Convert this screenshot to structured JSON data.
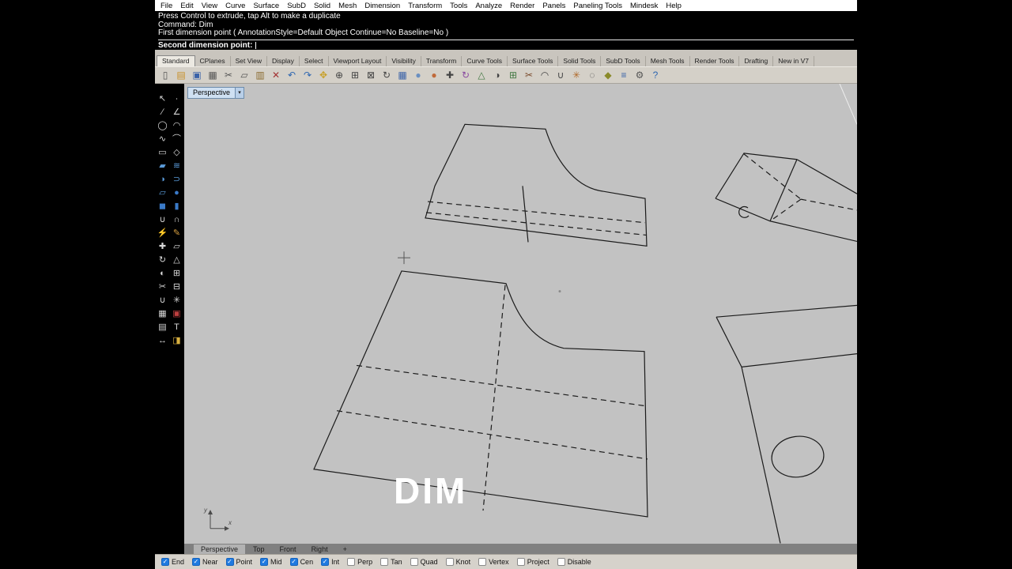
{
  "colors": {
    "accent_blue": "#1f7ae0",
    "viewport_bg": "#c2c2c2",
    "chrome_bg": "#d4d0c8",
    "command_bg": "#000000",
    "wire": "#1b1b1b"
  },
  "menu": {
    "items": [
      "File",
      "Edit",
      "View",
      "Curve",
      "Surface",
      "SubD",
      "Solid",
      "Mesh",
      "Dimension",
      "Transform",
      "Tools",
      "Analyze",
      "Render",
      "Panels",
      "Paneling Tools",
      "Mindesk",
      "Help"
    ]
  },
  "command": {
    "history": [
      "Press Control to extrude, tap Alt to make a duplicate",
      "Command: Dim",
      "First dimension point ( AnnotationStyle=Default Object Continue=No Baseline=No )"
    ],
    "prompt": "Second dimension point:"
  },
  "toolbar_tabs": {
    "tabs": [
      {
        "label": "Standard",
        "active": true
      },
      {
        "label": "CPlanes"
      },
      {
        "label": "Set View"
      },
      {
        "label": "Display"
      },
      {
        "label": "Select"
      },
      {
        "label": "Viewport Layout"
      },
      {
        "label": "Visibility"
      },
      {
        "label": "Transform"
      },
      {
        "label": "Curve Tools"
      },
      {
        "label": "Surface Tools"
      },
      {
        "label": "Solid Tools"
      },
      {
        "label": "SubD Tools"
      },
      {
        "label": "Mesh Tools"
      },
      {
        "label": "Render Tools"
      },
      {
        "label": "Drafting"
      },
      {
        "label": "New in V7"
      }
    ]
  },
  "toolbar": {
    "icons": [
      {
        "name": "new-file-icon",
        "glyph": "▯",
        "color": "#555555"
      },
      {
        "name": "open-file-icon",
        "glyph": "▤",
        "color": "#c89028"
      },
      {
        "name": "save-icon",
        "glyph": "▣",
        "color": "#3a62a8"
      },
      {
        "name": "print-icon",
        "glyph": "▦",
        "color": "#555555"
      },
      {
        "name": "cut-icon",
        "glyph": "✂",
        "color": "#555555"
      },
      {
        "name": "copy-icon",
        "glyph": "▱",
        "color": "#555555"
      },
      {
        "name": "paste-icon",
        "glyph": "▥",
        "color": "#8a6b2f"
      },
      {
        "name": "delete-icon",
        "glyph": "✕",
        "color": "#a33333"
      },
      {
        "name": "undo-icon",
        "glyph": "↶",
        "color": "#2e66b0"
      },
      {
        "name": "redo-icon",
        "glyph": "↷",
        "color": "#2e66b0"
      },
      {
        "name": "pan-icon",
        "glyph": "✥",
        "color": "#c8a028"
      },
      {
        "name": "zoom-icon",
        "glyph": "⊕",
        "color": "#444444"
      },
      {
        "name": "zoom-window-icon",
        "glyph": "⊞",
        "color": "#444444"
      },
      {
        "name": "zoom-extents-icon",
        "glyph": "⊠",
        "color": "#444444"
      },
      {
        "name": "rotate-view-icon",
        "glyph": "↻",
        "color": "#444444"
      },
      {
        "name": "viewport-layout-icon",
        "glyph": "▦",
        "color": "#3a62a8"
      },
      {
        "name": "shaded-view-icon",
        "glyph": "●",
        "color": "#6a8fc0"
      },
      {
        "name": "render-icon",
        "glyph": "●",
        "color": "#c06a3a"
      },
      {
        "name": "move-icon",
        "glyph": "✚",
        "color": "#444444"
      },
      {
        "name": "rotate-icon",
        "glyph": "↻",
        "color": "#8a4aa0"
      },
      {
        "name": "scale-icon",
        "glyph": "△",
        "color": "#447a44"
      },
      {
        "name": "mirror-icon",
        "glyph": "◑",
        "color": "#444444"
      },
      {
        "name": "array-icon",
        "glyph": "⊞",
        "color": "#447a44"
      },
      {
        "name": "trim-icon",
        "glyph": "✂",
        "color": "#7a4a2a"
      },
      {
        "name": "fillet-icon",
        "glyph": "◠",
        "color": "#444444"
      },
      {
        "name": "join-icon",
        "glyph": "∪",
        "color": "#444444"
      },
      {
        "name": "explode-icon",
        "glyph": "✳",
        "color": "#b06a2a"
      },
      {
        "name": "hide-icon",
        "glyph": "◌",
        "color": "#444444"
      },
      {
        "name": "lock-icon",
        "glyph": "◆",
        "color": "#8a8a2a"
      },
      {
        "name": "layers-icon",
        "glyph": "≡",
        "color": "#3a62a8"
      },
      {
        "name": "settings-gear-icon",
        "glyph": "⚙",
        "color": "#555555"
      },
      {
        "name": "help-icon",
        "glyph": "?",
        "color": "#2e66b0"
      }
    ]
  },
  "sidebar": {
    "icons": [
      {
        "name": "select-arrow-icon",
        "glyph": "↖",
        "color": "#d8d8d8"
      },
      {
        "name": "point-icon",
        "glyph": "∙",
        "color": "#d8d8d8"
      },
      {
        "name": "line-icon",
        "glyph": "∕",
        "color": "#d8d8d8"
      },
      {
        "name": "polyline-icon",
        "glyph": "∠",
        "color": "#d8d8d8"
      },
      {
        "name": "circle-icon",
        "glyph": "◯",
        "color": "#d8d8d8"
      },
      {
        "name": "arc-icon",
        "glyph": "◠",
        "color": "#d8d8d8"
      },
      {
        "name": "curve-icon",
        "glyph": "∿",
        "color": "#d8d8d8"
      },
      {
        "name": "interp-curve-icon",
        "glyph": "⌒",
        "color": "#d8d8d8"
      },
      {
        "name": "rectangle-icon",
        "glyph": "▭",
        "color": "#d8d8d8"
      },
      {
        "name": "polygon-icon",
        "glyph": "◇",
        "color": "#d8d8d8"
      },
      {
        "name": "surface-plane-icon",
        "glyph": "▰",
        "color": "#5a9ad8"
      },
      {
        "name": "loft-icon",
        "glyph": "≋",
        "color": "#5a9ad8"
      },
      {
        "name": "revolve-icon",
        "glyph": "◑",
        "color": "#5a9ad8"
      },
      {
        "name": "sweep-icon",
        "glyph": "⊃",
        "color": "#5a9ad8"
      },
      {
        "name": "extrude-icon",
        "glyph": "▱",
        "color": "#5a9ad8"
      },
      {
        "name": "sphere-icon",
        "glyph": "●",
        "color": "#3a7ac8"
      },
      {
        "name": "box-icon",
        "glyph": "◼",
        "color": "#3a7ac8"
      },
      {
        "name": "cylinder-icon",
        "glyph": "▮",
        "color": "#3a7ac8"
      },
      {
        "name": "boolean-union-icon",
        "glyph": "∪",
        "color": "#d8d8d8"
      },
      {
        "name": "boolean-difference-icon",
        "glyph": "∩",
        "color": "#d8d8d8"
      },
      {
        "name": "flash-icon",
        "glyph": "⚡",
        "color": "#e8c030"
      },
      {
        "name": "annotate-pencil-icon",
        "glyph": "✎",
        "color": "#d8a040"
      },
      {
        "name": "move-icon",
        "glyph": "✚",
        "color": "#d8d8d8"
      },
      {
        "name": "copy-object-icon",
        "glyph": "▱",
        "color": "#d8d8d8"
      },
      {
        "name": "rotate-icon",
        "glyph": "↻",
        "color": "#d8d8d8"
      },
      {
        "name": "scale-icon",
        "glyph": "△",
        "color": "#d8d8d8"
      },
      {
        "name": "mirror-icon",
        "glyph": "◐",
        "color": "#d8d8d8"
      },
      {
        "name": "array-icon",
        "glyph": "⊞",
        "color": "#d8d8d8"
      },
      {
        "name": "trim-icon",
        "glyph": "✂",
        "color": "#d8d8d8"
      },
      {
        "name": "split-icon",
        "glyph": "⊟",
        "color": "#d8d8d8"
      },
      {
        "name": "join-icon",
        "glyph": "∪",
        "color": "#d8d8d8"
      },
      {
        "name": "explode-icon",
        "glyph": "✳",
        "color": "#d8d8d8"
      },
      {
        "name": "group-icon",
        "glyph": "▦",
        "color": "#d8d8d8"
      },
      {
        "name": "block-icon",
        "glyph": "▣",
        "color": "#c04040"
      },
      {
        "name": "hatch-icon",
        "glyph": "▤",
        "color": "#d8d8d8"
      },
      {
        "name": "text-icon",
        "glyph": "T",
        "color": "#d8d8d8"
      },
      {
        "name": "dimension-icon",
        "glyph": "↔",
        "color": "#d8d8d8"
      },
      {
        "name": "paint-icon",
        "glyph": "◨",
        "color": "#d8b040"
      }
    ]
  },
  "viewport": {
    "title": "Perspective",
    "overlay": "DIM",
    "axis": {
      "x": "x",
      "y": "y"
    }
  },
  "viewport_tabs": {
    "tabs": [
      {
        "label": "Perspective",
        "active": true
      },
      {
        "label": "Top"
      },
      {
        "label": "Front"
      },
      {
        "label": "Right"
      },
      {
        "label": "+"
      }
    ]
  },
  "status": {
    "osnaps": [
      {
        "label": "End",
        "checked": true
      },
      {
        "label": "Near",
        "checked": true
      },
      {
        "label": "Point",
        "checked": true
      },
      {
        "label": "Mid",
        "checked": true
      },
      {
        "label": "Cen",
        "checked": true
      },
      {
        "label": "Int",
        "checked": true
      },
      {
        "label": "Perp",
        "checked": false
      },
      {
        "label": "Tan",
        "checked": false
      },
      {
        "label": "Quad",
        "checked": false
      },
      {
        "label": "Knot",
        "checked": false
      },
      {
        "label": "Vertex",
        "checked": false
      },
      {
        "label": "Project",
        "checked": false
      },
      {
        "label": "Disable",
        "checked": false
      }
    ]
  }
}
